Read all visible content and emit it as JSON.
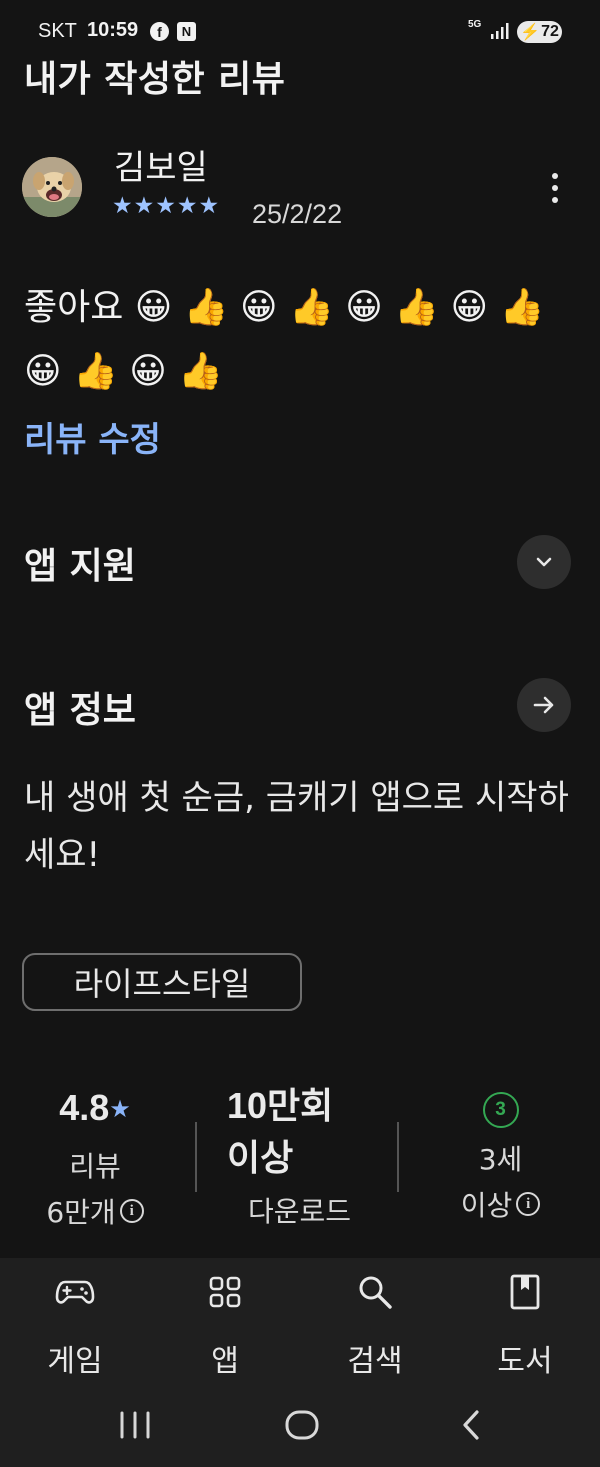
{
  "status_bar": {
    "carrier": "SKT",
    "time": "10:59",
    "notification_icons": [
      "facebook-icon",
      "naver-icon"
    ],
    "network": "5G",
    "battery": "72"
  },
  "page": {
    "title": "내가 작성한 리뷰"
  },
  "review": {
    "author": "김보일",
    "rating": 5,
    "stars": "★★★★★",
    "date": "25/2/22",
    "text": "좋아요 😀 👍 😀 👍 😀 👍 😀 👍 😀 👍 😀 👍",
    "edit_label": "리뷰 수정"
  },
  "app_support": {
    "title": "앱 지원"
  },
  "app_info": {
    "title": "앱 정보",
    "description": "내 생애 첫 순금, 금캐기 앱으로 시작하세요!",
    "category": "라이프스타일"
  },
  "stats": {
    "rating": {
      "value": "4.8",
      "star": "★",
      "label": "리뷰",
      "count": "6만개"
    },
    "downloads": {
      "value_line1": "10만회",
      "value_line2": "이상",
      "label": "다운로드"
    },
    "age": {
      "badge": "3",
      "line1": "3세",
      "line2": "이상"
    }
  },
  "bottom_nav": {
    "items": [
      {
        "label": "게임",
        "icon": "gamepad-icon"
      },
      {
        "label": "앱",
        "icon": "apps-grid-icon"
      },
      {
        "label": "검색",
        "icon": "search-icon"
      },
      {
        "label": "도서",
        "icon": "book-icon"
      }
    ]
  },
  "colors": {
    "background": "#141414",
    "accent": "#8ab4f8",
    "age_badge": "#34a853"
  }
}
